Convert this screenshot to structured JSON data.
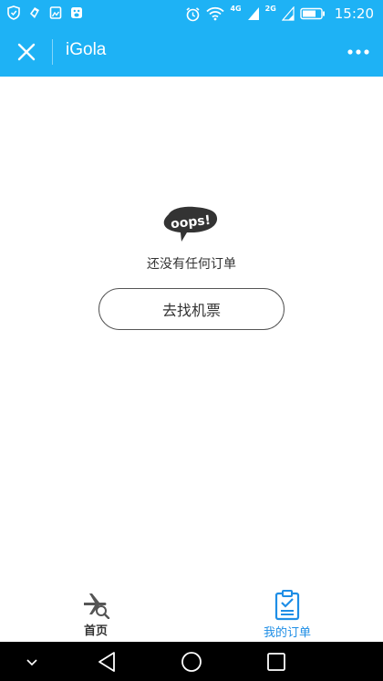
{
  "status_bar": {
    "time": "15:20",
    "net_4g": "4G",
    "net_2g": "2G",
    "icons": [
      "shield-icon",
      "app-icon",
      "gallery-icon",
      "paw-icon",
      "alarm-icon",
      "wifi-icon",
      "signal-icon",
      "battery-icon"
    ]
  },
  "header": {
    "title": "iGola",
    "close_icon": "close-icon",
    "more_icon": "more-icon"
  },
  "empty_state": {
    "oops_badge": "oops!",
    "message": "还没有任何订单",
    "button_label": "去找机票"
  },
  "tab_bar": {
    "tabs": [
      {
        "label": "首页",
        "icon": "flight-search-icon",
        "active": false
      },
      {
        "label": "我的订单",
        "icon": "clipboard-check-icon",
        "active": true
      }
    ],
    "active_color": "#1e8ee6"
  },
  "nav_bar": {
    "icons": [
      "chevron-down-icon",
      "back-icon",
      "home-icon",
      "recents-icon"
    ]
  },
  "colors": {
    "brand": "#1eb2f5",
    "accent": "#1e8ee6"
  }
}
